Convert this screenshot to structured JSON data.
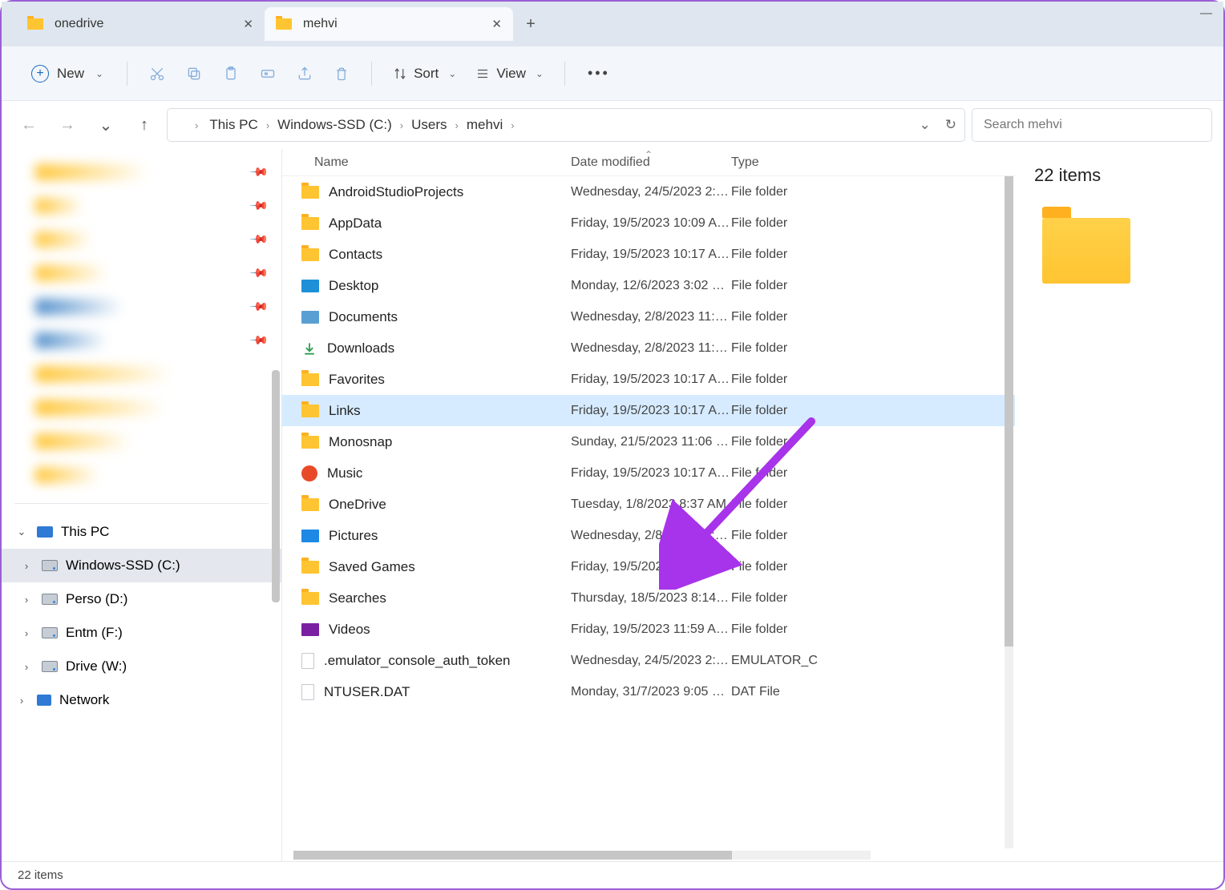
{
  "tabs": [
    {
      "label": "onedrive",
      "active": false
    },
    {
      "label": "mehvi",
      "active": true
    }
  ],
  "toolbar": {
    "new_label": "New",
    "sort_label": "Sort",
    "view_label": "View"
  },
  "breadcrumbs": [
    "This PC",
    "Windows-SSD (C:)",
    "Users",
    "mehvi"
  ],
  "search": {
    "placeholder": "Search mehvi"
  },
  "columns": {
    "name": "Name",
    "date": "Date modified",
    "type": "Type"
  },
  "files": [
    {
      "name": "AndroidStudioProjects",
      "date": "Wednesday, 24/5/2023 2:…",
      "type": "File folder",
      "icon": "folder"
    },
    {
      "name": "AppData",
      "date": "Friday, 19/5/2023 10:09 A…",
      "type": "File folder",
      "icon": "folder"
    },
    {
      "name": "Contacts",
      "date": "Friday, 19/5/2023 10:17 A…",
      "type": "File folder",
      "icon": "folder"
    },
    {
      "name": "Desktop",
      "date": "Monday, 12/6/2023 3:02 …",
      "type": "File folder",
      "icon": "desktop"
    },
    {
      "name": "Documents",
      "date": "Wednesday, 2/8/2023 11:…",
      "type": "File folder",
      "icon": "docs"
    },
    {
      "name": "Downloads",
      "date": "Wednesday, 2/8/2023 11:…",
      "type": "File folder",
      "icon": "down"
    },
    {
      "name": "Favorites",
      "date": "Friday, 19/5/2023 10:17 A…",
      "type": "File folder",
      "icon": "folder"
    },
    {
      "name": "Links",
      "date": "Friday, 19/5/2023 10:17 A…",
      "type": "File folder",
      "icon": "folder",
      "selected": true
    },
    {
      "name": "Monosnap",
      "date": "Sunday, 21/5/2023 11:06 …",
      "type": "File folder",
      "icon": "folder"
    },
    {
      "name": "Music",
      "date": "Friday, 19/5/2023 10:17 A…",
      "type": "File folder",
      "icon": "music"
    },
    {
      "name": "OneDrive",
      "date": "Tuesday, 1/8/2023 8:37 AM",
      "type": "File folder",
      "icon": "folder"
    },
    {
      "name": "Pictures",
      "date": "Wednesday, 2/8/2023 11:…",
      "type": "File folder",
      "icon": "pics"
    },
    {
      "name": "Saved Games",
      "date": "Friday, 19/5/2023 10:17 A…",
      "type": "File folder",
      "icon": "folder"
    },
    {
      "name": "Searches",
      "date": "Thursday, 18/5/2023 8:14 …",
      "type": "File folder",
      "icon": "folder"
    },
    {
      "name": "Videos",
      "date": "Friday, 19/5/2023 11:59 A…",
      "type": "File folder",
      "icon": "vids"
    },
    {
      "name": ".emulator_console_auth_token",
      "date": "Wednesday, 24/5/2023 2:…",
      "type": "EMULATOR_C",
      "icon": "file"
    },
    {
      "name": "NTUSER.DAT",
      "date": "Monday, 31/7/2023 9:05 …",
      "type": "DAT File",
      "icon": "file"
    }
  ],
  "tree": {
    "thispc": "This PC",
    "drives": [
      {
        "label": "Windows-SSD (C:)",
        "selected": true
      },
      {
        "label": "Perso (D:)"
      },
      {
        "label": "Entm (F:)"
      },
      {
        "label": "Drive  (W:)"
      }
    ],
    "network": "Network"
  },
  "details": {
    "title": "22 items"
  },
  "statusbar": {
    "text": "22 items"
  }
}
